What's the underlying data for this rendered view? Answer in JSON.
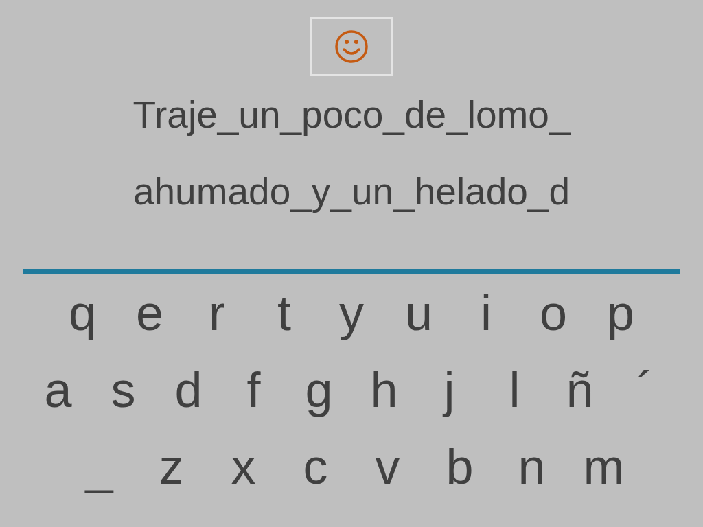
{
  "sentence_lines": [
    "Traje_un_poco_de_lomo_",
    "ahumado_y_un_helado_d"
  ],
  "keyboard_rows": [
    [
      "q",
      "e",
      "r",
      "t",
      "y",
      "u",
      "i",
      "o",
      "p"
    ],
    [
      "a",
      "s",
      "d",
      "f",
      "g",
      "h",
      "j",
      "l",
      "ñ",
      "´"
    ],
    [
      "_",
      "z",
      "x",
      "c",
      "v",
      "b",
      "n",
      "m"
    ]
  ]
}
